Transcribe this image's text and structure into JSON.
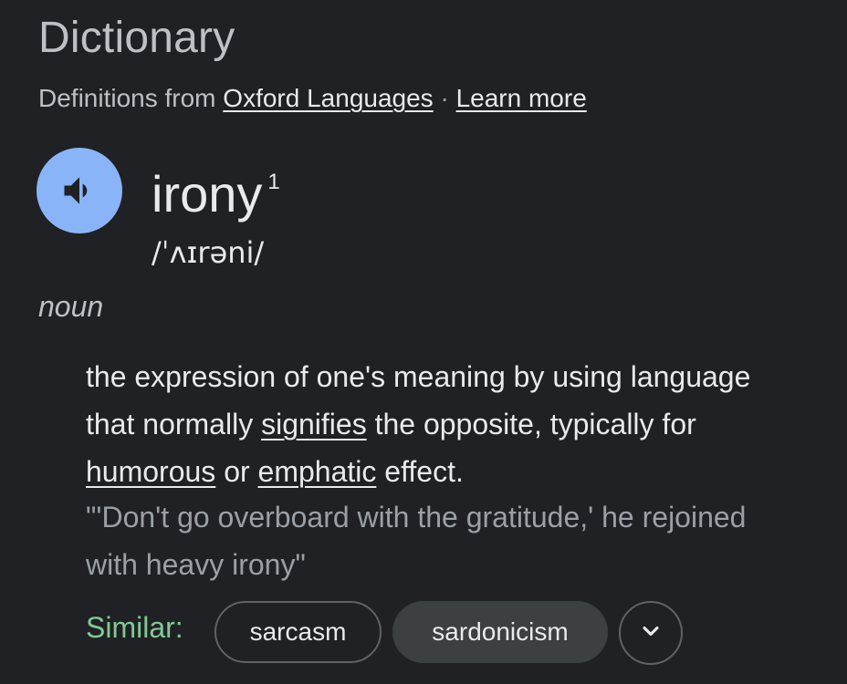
{
  "header": {
    "title": "Dictionary",
    "source_prefix": "Definitions from",
    "source_link": "Oxford Languages",
    "separator": "·",
    "learn_more": "Learn more"
  },
  "entry": {
    "word": "irony",
    "homograph": "1",
    "pronunciation": "/ˈʌɪrəni/",
    "part_of_speech": "noun",
    "speaker_icon": "volume-icon",
    "definition": {
      "part1": "the expression of one's meaning by using language that normally",
      "link1": "signifies",
      "part2": "the opposite, typically for",
      "link2": "humorous",
      "part3": "or",
      "link3": "emphatic",
      "part4": "effect."
    },
    "example": "\"'Don't go overboard with the gratitude,' he rejoined with heavy irony\""
  },
  "similar": {
    "label": "Similar:",
    "chips": [
      "sarcasm",
      "sardonicism"
    ],
    "expand_icon": "chevron-down-icon"
  },
  "colors": {
    "background": "#202124",
    "speaker_button": "#8ab4f8",
    "similar_label": "#81c995",
    "example_text": "#9aa0a6"
  }
}
